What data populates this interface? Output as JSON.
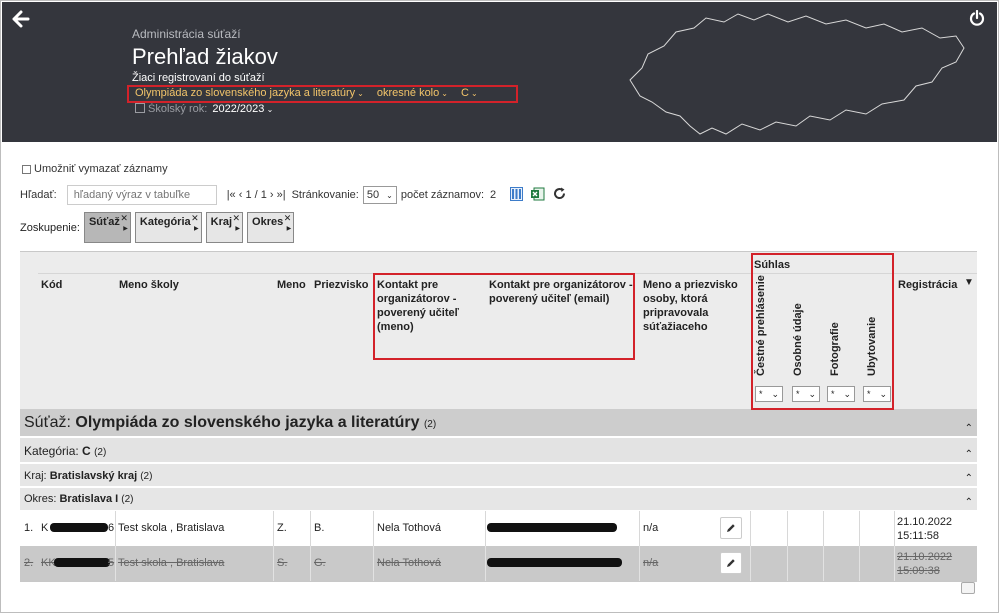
{
  "header": {
    "breadcrumb": "Administrácia súťaží",
    "title": "Prehľad žiakov",
    "subtitle": "Žiaci registrovaní do súťaží",
    "filters": [
      "Olympiáda zo slovenského jazyka a literatúry",
      "okresné kolo",
      "C"
    ],
    "school_year_label": "Školský rok:",
    "school_year": "2022/2023"
  },
  "toolbar": {
    "allow_delete_label": "Umožniť vymazať záznamy",
    "search_label": "Hľadať:",
    "search_placeholder": "hľadaný výraz v tabuľke",
    "pager": "|« ‹ 1 / 1 › »|",
    "paging_label": "Stránkovanie:",
    "per_page": "50",
    "count_label": "počet záznamov:",
    "count": "2"
  },
  "grouping": {
    "label": "Zoskupenie:",
    "chips": [
      "Súťaž",
      "Kategória",
      "Kraj",
      "Okres"
    ]
  },
  "table": {
    "headers": {
      "code": "Kód",
      "school": "Meno školy",
      "name": "Meno",
      "surname": "Priezvisko",
      "contact_name": "Kontakt pre organizátorov - poverený učiteľ (meno)",
      "contact_email": "Kontakt pre organizátorov - poverený učiteľ (email)",
      "preparer": "Meno a priezvisko osoby, ktorá pripravovala súťažiaceho",
      "consent": "Súhlas",
      "consent_cols": [
        "Čestné prehlásenie",
        "Osobné údaje",
        "Fotografie",
        "Ubytovanie"
      ],
      "consent_filter": "*",
      "registration": "Registrácia"
    },
    "groups": {
      "competition_prefix": "Súťaž:",
      "competition": "Olympiáda zo slovenského jazyka a literatúry",
      "competition_count": "(2)",
      "category_prefix": "Kategória:",
      "category": "C",
      "category_count": "(2)",
      "region_prefix": "Kraj:",
      "region": "Bratislavský kraj",
      "region_count": "(2)",
      "district_prefix": "Okres:",
      "district": "Bratislava I",
      "district_count": "(2)"
    },
    "rows": [
      {
        "num": "1.",
        "code_start": "K",
        "code_end": "6",
        "school": "Test skola , Bratislava",
        "name": "Z.",
        "surname": "B.",
        "contact": "Nela Tothová",
        "preparer": "n/a",
        "reg_date": "21.10.2022",
        "reg_time": "15:11:58"
      },
      {
        "num": "2.",
        "code_start": "KK",
        "code_end": "5",
        "school": "Test skola , Bratislava",
        "name": "S.",
        "surname": "G.",
        "contact": "Nela Tothová",
        "preparer": "n/a",
        "reg_date": "21.10.2022",
        "reg_time": "15:09:38"
      }
    ]
  },
  "colors": {
    "header_bg": "#34363d",
    "filter_accent": "#f2c46a",
    "highlight_box": "#d3222a",
    "excel_green": "#1f7a3f",
    "columns_blue": "#3d7cc9"
  }
}
